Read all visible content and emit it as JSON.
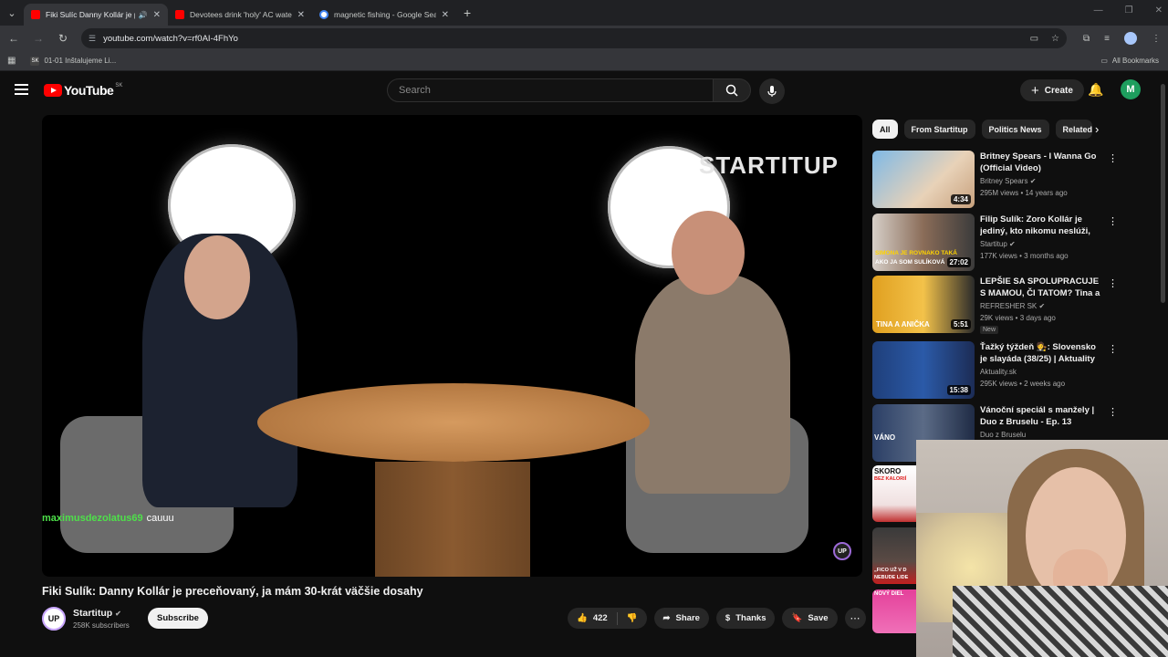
{
  "browser": {
    "tabs": [
      {
        "title": "Fiki Sulíc Danny Kollár je pr",
        "active": true,
        "audio": true
      },
      {
        "title": "Devotees drink 'holy' AC water",
        "active": false
      },
      {
        "title": "magnetic fishing - Google Sear",
        "active": false
      }
    ],
    "url": "youtube.com/watch?v=rf0AI-4FhYo",
    "bookmark": "01-01 Inštalujeme Li...",
    "all_bookmarks": "All Bookmarks"
  },
  "header": {
    "logo": "YouTube",
    "region": "SK",
    "search_placeholder": "Search",
    "create": "Create",
    "avatar_letter": "M"
  },
  "video": {
    "overlay_brand": "STARTITUP",
    "chat_user": "maximusdezolatus69",
    "chat_text": "cauuu",
    "watermark": "UP",
    "title": "Fiki Sulík: Danny Kollár je preceňovaný, ja mám 30-krát väčšie dosahy"
  },
  "channel": {
    "avatar": "UP",
    "name": "Startitup",
    "subs": "258K subscribers",
    "subscribe": "Subscribe"
  },
  "actions": {
    "likes": "422",
    "share": "Share",
    "thanks": "Thanks",
    "save": "Save"
  },
  "chips": [
    "All",
    "From Startitup",
    "Politics News",
    "Related"
  ],
  "recommendations": [
    {
      "title": "Britney Spears - I Wanna Go (Official Video)",
      "channel": "Britney Spears",
      "meta": "295M views • 14 years ago",
      "duration": "4:34",
      "verified": true,
      "new": ""
    },
    {
      "title": "Filip Sulík: Zoro Kollár je jediný, kto nikomu neslúži, peniaze h...",
      "channel": "Startitup",
      "meta": "177K views • 3 months ago",
      "duration": "27:02",
      "verified": true,
      "new": ""
    },
    {
      "title": "LEPŠIE SA SPOLUPRACUJE S MAMOU, ČI TATOM? Tina a ...",
      "channel": "REFRESHER SK",
      "meta": "29K views • 3 days ago",
      "duration": "5:51",
      "verified": true,
      "new": "New"
    },
    {
      "title": "Ťažký týždeň 🧑‍⚖️: Slovensko je slayáda (38/25) | Aktuality",
      "channel": "Aktuality.sk",
      "meta": "295K views • 2 weeks ago",
      "duration": "15:38",
      "verified": false,
      "new": ""
    },
    {
      "title": "Vánoční speciál s manžely | Duo z Bruselu - Ep. 13",
      "channel": "Duo z Bruselu",
      "meta": "",
      "duration": "",
      "verified": false,
      "new": ""
    }
  ],
  "thumb_texts": {
    "t2a": "SIMONA JE ROVNAKO TAKÁ",
    "t2b": "AKO JA SOM SULÍKOVÁ",
    "t3": "TINA A ANIČKA",
    "t5": "VÁNO",
    "t6": "SKORO",
    "t6b": "BEZ KALORIÍ",
    "t7a": "„FICO UŽ V D",
    "t7b": "NEBUDE LIDE",
    "t8": "NOVÝ DIEL"
  },
  "colors": {
    "chat_user": "#4ee04a",
    "yt_red": "#ff0000",
    "avatar_green": "#1e9e5e"
  }
}
